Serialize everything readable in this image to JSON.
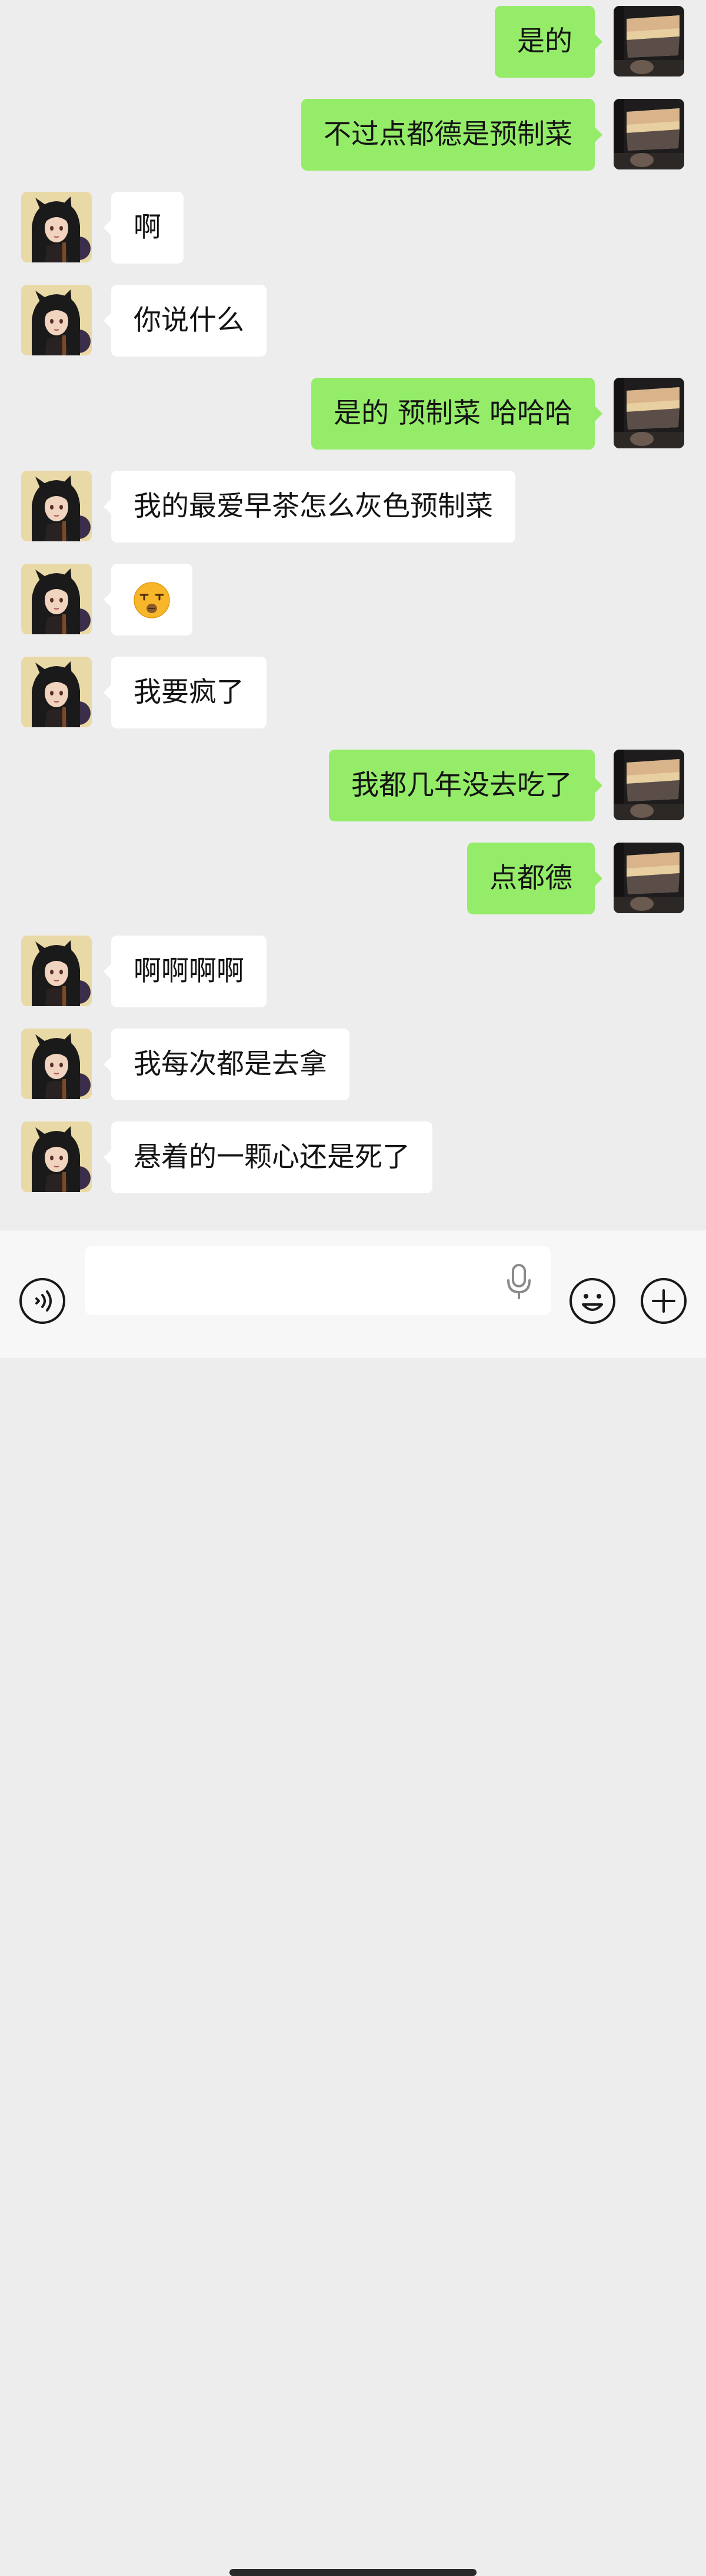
{
  "conversation": {
    "messages": [
      {
        "side": "out",
        "text": "是的"
      },
      {
        "side": "out",
        "text": "不过点都德是预制菜"
      },
      {
        "side": "in",
        "text": "啊"
      },
      {
        "side": "in",
        "text": "你说什么"
      },
      {
        "side": "out",
        "text": "是的 预制菜 哈哈哈"
      },
      {
        "side": "in",
        "text": "我的最爱早茶怎么灰色预制菜"
      },
      {
        "side": "in",
        "text": "",
        "icon": "speechless-face-emoji-icon"
      },
      {
        "side": "in",
        "text": "我要疯了"
      },
      {
        "side": "out",
        "text": "我都几年没去吃了"
      },
      {
        "side": "out",
        "text": "点都德"
      },
      {
        "side": "in",
        "text": "啊啊啊啊"
      },
      {
        "side": "in",
        "text": "我每次都是去拿"
      },
      {
        "side": "in",
        "text": "悬着的一颗心还是死了"
      }
    ]
  },
  "input_bar": {
    "text_value": "",
    "placeholder": "",
    "voice_icon": "voice-mode-icon",
    "mic_icon": "microphone-icon",
    "emoji_icon": "emoji-icon",
    "plus_icon": "plus-icon"
  },
  "colors": {
    "background": "#ededed",
    "outgoing_bubble": "#95ec69",
    "incoming_bubble": "#ffffff",
    "input_bar": "#f7f7f7"
  }
}
